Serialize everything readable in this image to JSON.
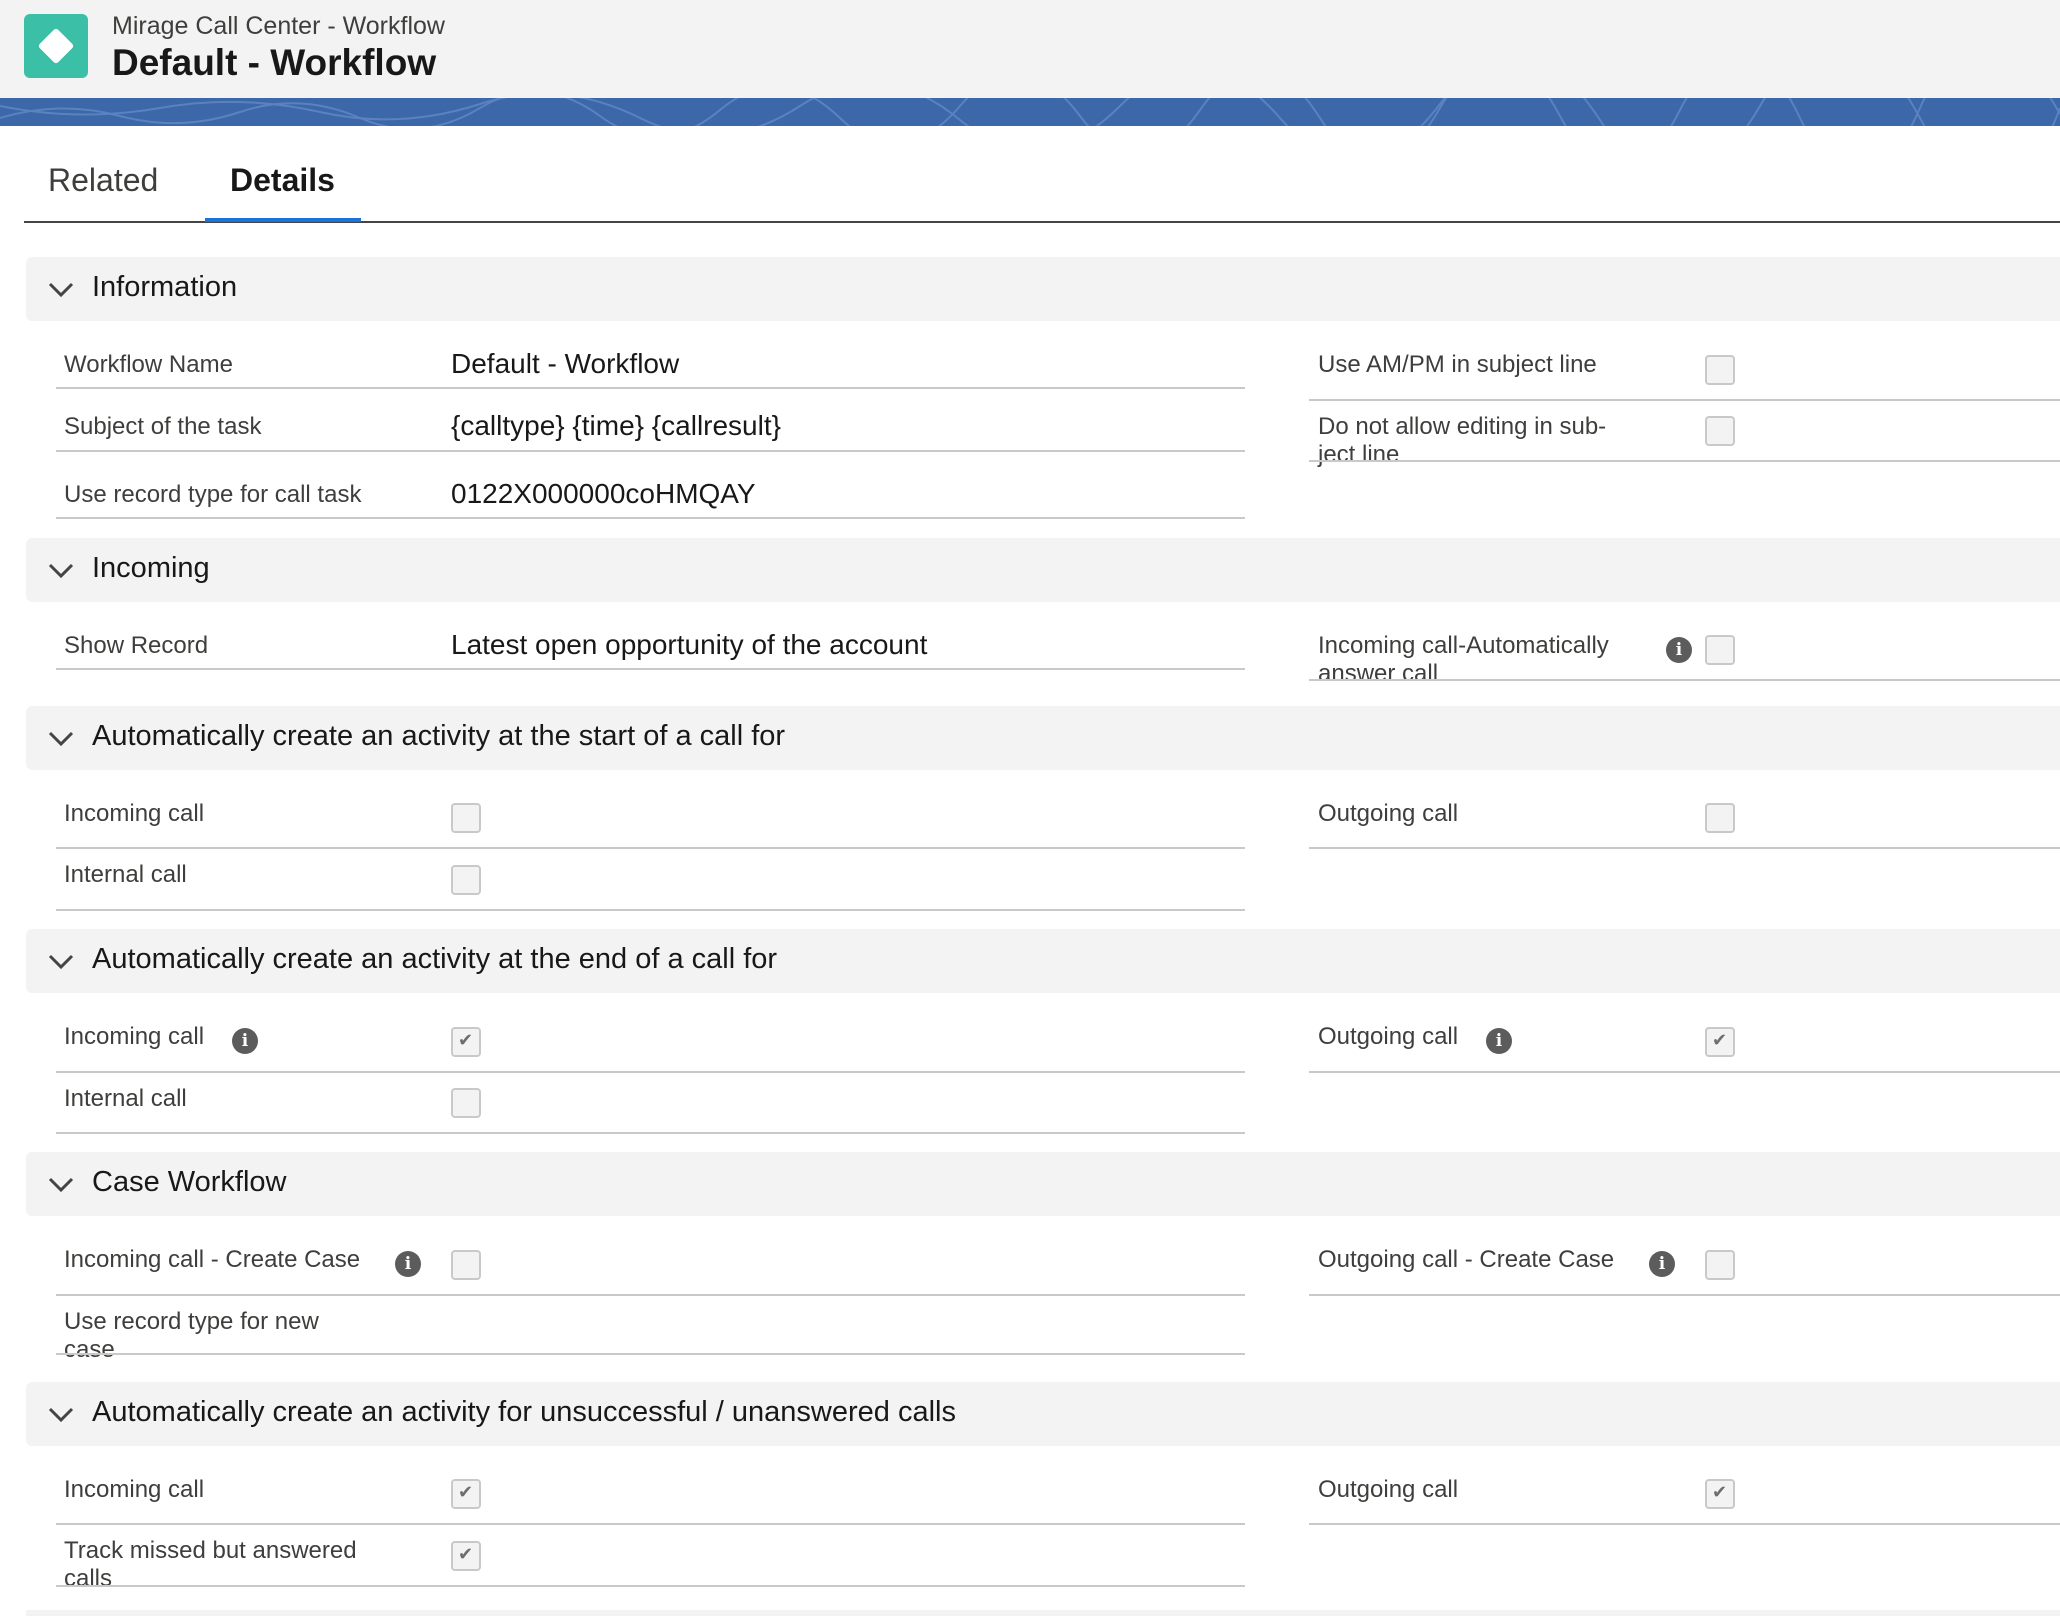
{
  "header": {
    "app_subtitle": "Mirage Call Center - Workflow",
    "record_title": "Default - Workflow",
    "icon": "diamond-app-icon"
  },
  "tabs": [
    {
      "label": "Related",
      "active": false
    },
    {
      "label": "Details",
      "active": true
    }
  ],
  "sections": {
    "information": {
      "title": "Information",
      "workflow_name_label": "Workflow Name",
      "workflow_name_value": "Default - Workflow",
      "subject_label": "Subject of the task",
      "subject_value": "{calltype} {time} {callresult}",
      "record_type_label": "Use record type for call task",
      "record_type_value": "0122X000000coHMQAY",
      "ampm_label": "Use AM/PM in subject line",
      "ampm_checked": false,
      "no_edit_label_1": "Do not allow editing in sub-",
      "no_edit_label_2": "ject line",
      "no_edit_checked": false
    },
    "incoming": {
      "title": "Incoming",
      "show_record_label": "Show Record",
      "show_record_value": "Latest open opportunity of the account",
      "auto_answer_label_1": "Incoming call-Automatically",
      "auto_answer_label_2": "answer call",
      "auto_answer_checked": false
    },
    "start_activity": {
      "title": "Automatically create an activity at the start of a call for",
      "incoming_label": "Incoming call",
      "incoming_checked": false,
      "outgoing_label": "Outgoing call",
      "outgoing_checked": false,
      "internal_label": "Internal call",
      "internal_checked": false
    },
    "end_activity": {
      "title": "Automatically create an activity at the end of a call for",
      "incoming_label": "Incoming call",
      "incoming_checked": true,
      "outgoing_label": "Outgoing call",
      "outgoing_checked": true,
      "internal_label": "Internal call",
      "internal_checked": false
    },
    "case_workflow": {
      "title": "Case Workflow",
      "incoming_case_label": "Incoming call - Create Case",
      "incoming_case_checked": false,
      "outgoing_case_label": "Outgoing call - Create Case",
      "outgoing_case_checked": false,
      "record_type_label_1": "Use record type for new",
      "record_type_label_2": "case"
    },
    "unsuccessful": {
      "title": "Automatically create an activity for unsuccessful / unanswered calls",
      "incoming_label": "Incoming call",
      "incoming_checked": true,
      "outgoing_label": "Outgoing call",
      "outgoing_checked": true,
      "missed_label_1": "Track missed but answered",
      "missed_label_2": "calls",
      "missed_checked": true
    }
  },
  "info_icon_glyph": "i",
  "colors": {
    "header_bg": "#f3f3f3",
    "app_icon": "#3bbfa6",
    "banner": "#3c67a8",
    "tab_accent": "#1b72d9",
    "section_bg": "#f3f3f3"
  }
}
